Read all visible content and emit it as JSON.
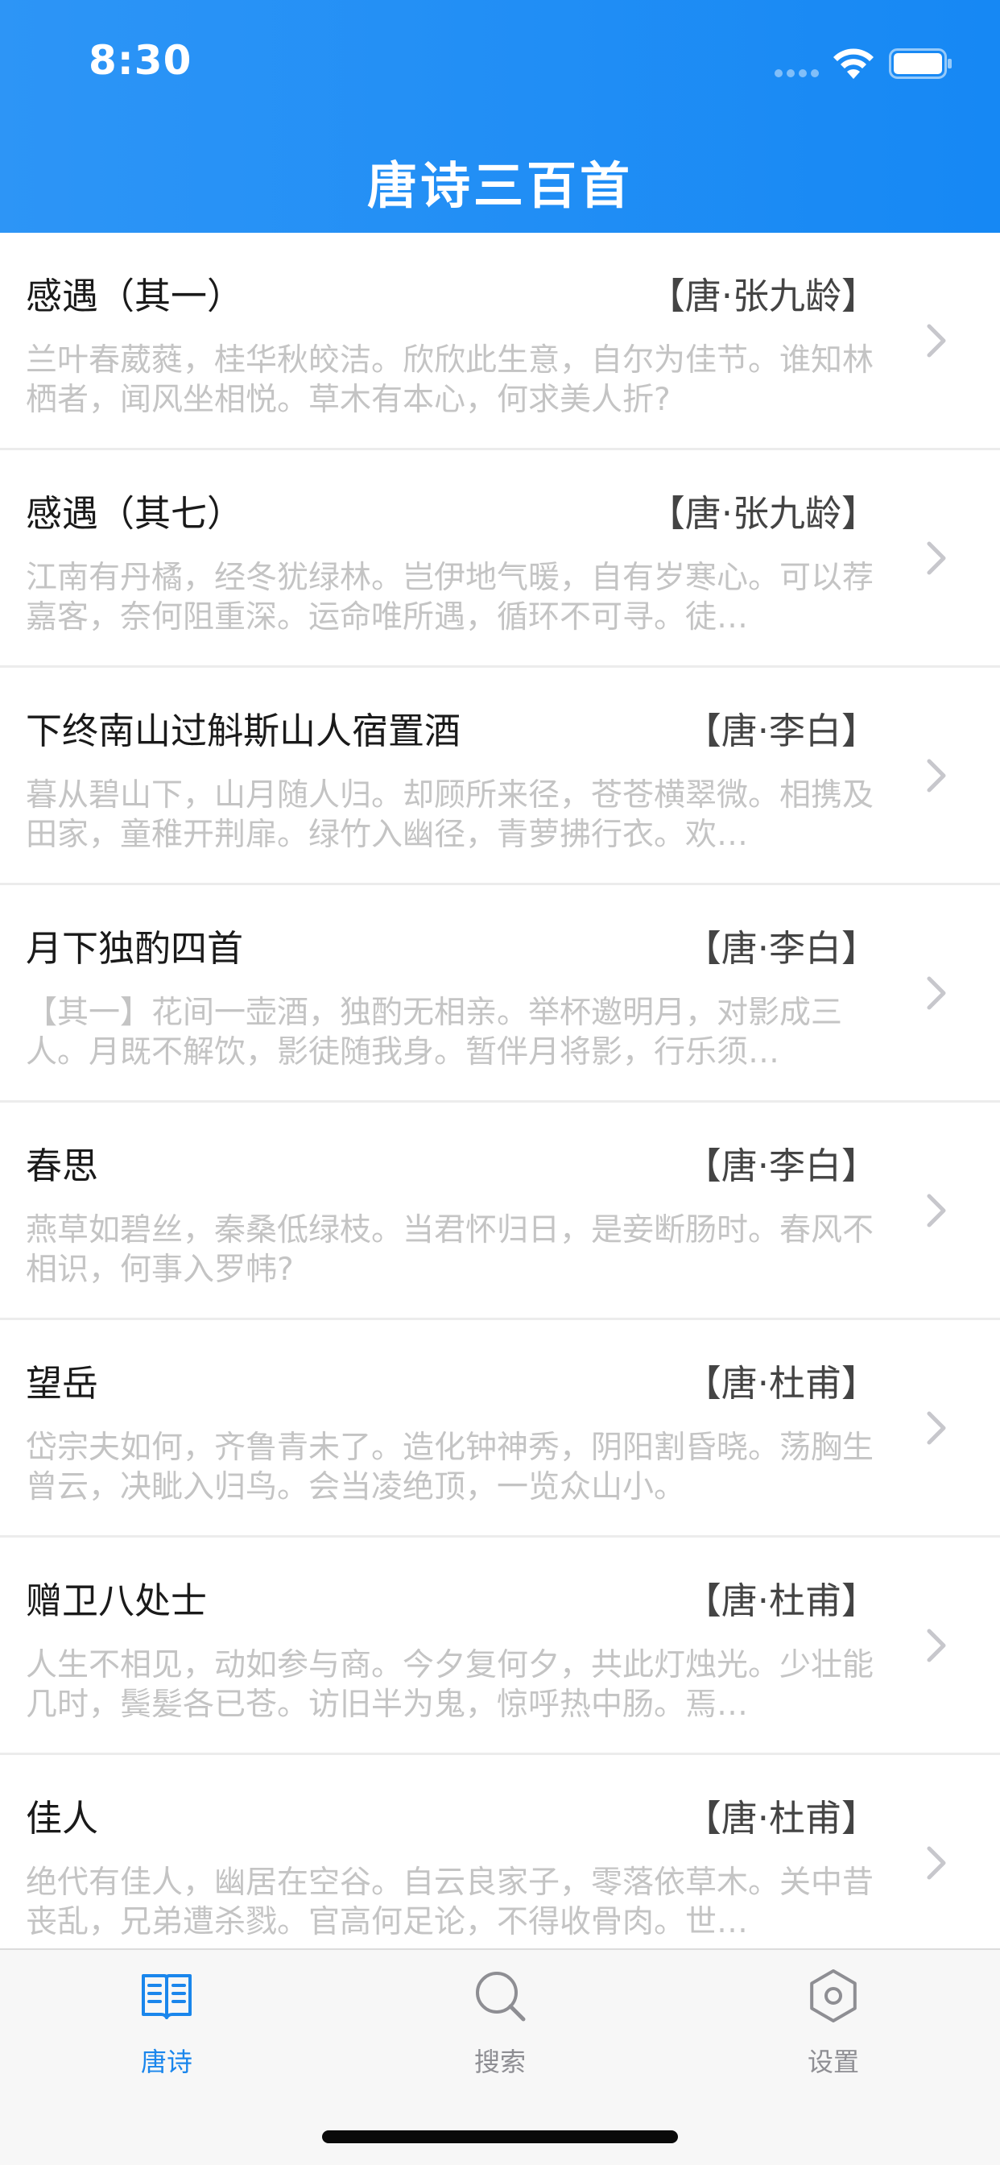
{
  "status_bar": {
    "time": "8:30"
  },
  "header": {
    "title": "唐诗三百首"
  },
  "poems": [
    {
      "title": "感遇（其一）",
      "author": "【唐·张九龄】",
      "excerpt": "兰叶春葳蕤，桂华秋皎洁。欣欣此生意，自尔为佳节。谁知林栖者，闻风坐相悦。草木有本心，何求美人折?"
    },
    {
      "title": "感遇（其七）",
      "author": "【唐·张九龄】",
      "excerpt": "江南有丹橘，经冬犹绿林。岂伊地气暖，自有岁寒心。可以荐嘉客，奈何阻重深。运命唯所遇，循环不可寻。徒…"
    },
    {
      "title": "下终南山过斛斯山人宿置酒",
      "author": "【唐·李白】",
      "excerpt": "暮从碧山下，山月随人归。却顾所来径，苍苍横翠微。相携及田家，童稚开荆扉。绿竹入幽径，青萝拂行衣。欢…"
    },
    {
      "title": "月下独酌四首",
      "author": "【唐·李白】",
      "excerpt": "【其一】花间一壶酒，独酌无相亲。举杯邀明月，对影成三人。月既不解饮，影徒随我身。暂伴月将影，行乐须…"
    },
    {
      "title": "春思",
      "author": "【唐·李白】",
      "excerpt": "燕草如碧丝，秦桑低绿枝。当君怀归日，是妾断肠时。春风不相识，何事入罗帏?"
    },
    {
      "title": "望岳",
      "author": "【唐·杜甫】",
      "excerpt": "岱宗夫如何，齐鲁青未了。造化钟神秀，阴阳割昏晓。荡胸生曾云，决眦入归鸟。会当凌绝顶，一览众山小。"
    },
    {
      "title": "赠卫八处士",
      "author": "【唐·杜甫】",
      "excerpt": "人生不相见，动如参与商。今夕复何夕，共此灯烛光。少壮能几时，鬓髪各已苍。访旧半为鬼，惊呼热中肠。焉…"
    },
    {
      "title": "佳人",
      "author": "【唐·杜甫】",
      "excerpt": "绝代有佳人，幽居在空谷。自云良家子，零落依草木。关中昔丧乱，兄弟遭杀戮。官高何足论，不得收骨肉。世…"
    }
  ],
  "tabs": [
    {
      "label": "唐诗",
      "icon": "book-icon",
      "active": true
    },
    {
      "label": "搜索",
      "icon": "search-icon",
      "active": false
    },
    {
      "label": "设置",
      "icon": "gear-icon",
      "active": false
    }
  ],
  "colors": {
    "header_blue": "#1688f4",
    "active_tab": "#1a86ec",
    "inactive_tab": "#8e8e93",
    "excerpt_gray": "#c4c4c4"
  }
}
